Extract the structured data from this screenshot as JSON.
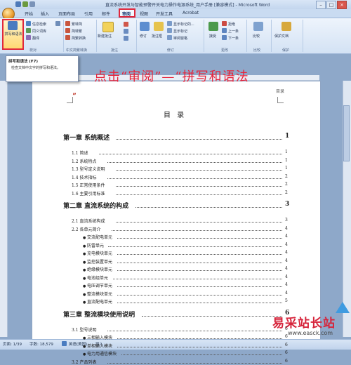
{
  "window": {
    "title": "直流系统开发与智能预警开关电力操作电源系统_用户手册 [兼容模式] - Microsoft Word",
    "controls": {
      "minimize": "–",
      "maximize": "□",
      "close": "×"
    }
  },
  "tabs": [
    "开始",
    "插入",
    "页面布局",
    "引用",
    "邮件",
    "审阅",
    "视图",
    "开发工具",
    "Acrobat"
  ],
  "active_tab": "审阅",
  "ribbon": {
    "proofing": {
      "spell_check": "拼写和语法",
      "research": "信息检索",
      "thesaurus": "同义词库",
      "translate": "翻译",
      "label": "校对"
    },
    "chinese_conversion": {
      "to_simplified": "繁转简",
      "to_traditional": "简转繁",
      "convert": "简繁转换",
      "label": "中文简繁转换"
    },
    "comments": {
      "new_comment": "新建批注",
      "label": "批注"
    },
    "tracking": {
      "track_changes": "修订",
      "balloons": "批注框",
      "display": "显示标记的...",
      "show_markup": "显示标记",
      "reviewing_pane": "审阅窗格",
      "label": "修订"
    },
    "changes": {
      "accept": "接受",
      "reject": "拒绝",
      "previous": "上一条",
      "next": "下一条",
      "label": "更改"
    },
    "compare": {
      "compare": "比较",
      "label": "比较"
    },
    "protect": {
      "protect_document": "保护文档",
      "label": "保护"
    }
  },
  "tooltip": {
    "title": "拼写和语法 (F7)",
    "description": "检查文档中文字的拼写和语法。"
  },
  "instruction": "点击“审阅”—“拼写和语法",
  "document": {
    "heading_mark": "目录",
    "title": "目 录",
    "toc": [
      {
        "level": "chapter",
        "text": "第一章 系统概述",
        "page": "1"
      },
      {
        "level": "section",
        "text": "1.1 简述",
        "page": "1"
      },
      {
        "level": "section",
        "text": "1.2 系统特点",
        "page": "1"
      },
      {
        "level": "section",
        "text": "1.3 型号定义说明",
        "page": "1"
      },
      {
        "level": "section",
        "text": "1.4 技术指标",
        "page": "2"
      },
      {
        "level": "section",
        "text": "1.5 正常使用条件",
        "page": "2"
      },
      {
        "level": "section",
        "text": "1.6 主要引用标准",
        "page": "2"
      },
      {
        "level": "chapter",
        "text": "第二章 直流系统的构成",
        "page": "3"
      },
      {
        "level": "section",
        "text": "2.1 直流系统构成",
        "page": "3"
      },
      {
        "level": "section",
        "text": "2.2 各单元简介",
        "page": "4"
      },
      {
        "level": "bullet",
        "text": "交流配电单元",
        "page": "4"
      },
      {
        "level": "bullet",
        "text": "防雷单元",
        "page": "4"
      },
      {
        "level": "bullet",
        "text": "充电模块单元",
        "page": "4"
      },
      {
        "level": "bullet",
        "text": "监控装置单元",
        "page": "4"
      },
      {
        "level": "bullet",
        "text": "绝缘模块单元",
        "page": "4"
      },
      {
        "level": "bullet",
        "text": "电池组单元",
        "page": "4"
      },
      {
        "level": "bullet",
        "text": "电压调节单元",
        "page": "4"
      },
      {
        "level": "bullet",
        "text": "整流模块单元",
        "page": "4"
      },
      {
        "level": "bullet",
        "text": "直流配电单元",
        "page": "5"
      },
      {
        "level": "chapter",
        "text": "第三章 整流模块使用说明",
        "page": "6"
      },
      {
        "level": "section",
        "text": "3.1 型号说明",
        "page": "6"
      },
      {
        "level": "bullet",
        "text": "三相输入模块",
        "page": "6"
      },
      {
        "level": "bullet",
        "text": "单相输入模块",
        "page": "6"
      },
      {
        "level": "bullet",
        "text": "电力用通信模块",
        "page": "6"
      },
      {
        "level": "section",
        "text": "3.2 产品列表",
        "page": "6"
      }
    ]
  },
  "status": {
    "page": "页面: 1/39",
    "words": "字数: 18,579",
    "language": "英语(美国)",
    "mode": "插入"
  },
  "watermark": {
    "brand": "易采站长站",
    "url": "www.easck.com"
  },
  "colors": {
    "highlight_red": "#e0283c",
    "ribbon_blue": "#d3e2f4"
  }
}
